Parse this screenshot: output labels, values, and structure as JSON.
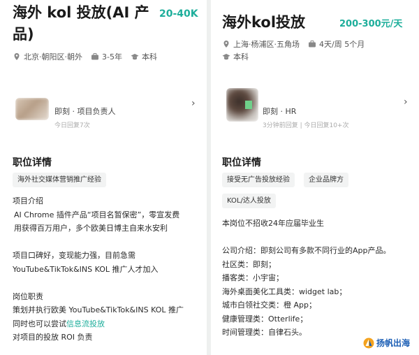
{
  "left": {
    "title_line1": "海外 kol 投放(AI 产",
    "title_line2": "品)",
    "salary": "20-40K",
    "location": "北京·朝阳区·朝外",
    "experience": "3-5年",
    "education": "本科",
    "hr_name": "即刻 · 项目负责人",
    "hr_status": "今日回复7次",
    "section_title": "职位详情",
    "tags": [
      "海外社交媒体营销推广经验"
    ],
    "lines": [
      "项目介绍",
      "AI Chrome 插件产品“项目名暂保密”，零宣发费",
      "用获得百万用户，多个欧美日博主自来水安利",
      "",
      "项目口碑好，变现能力强，目前急需",
      "YouTube&TikTok&INS KOL 推广人才加入",
      "",
      "岗位职责",
      "策划并执行欧美 YouTube&TikTok&INS KOL 推广"
    ],
    "line_hl_prefix": "同时也可以尝试",
    "line_hl_text": "信息流投放",
    "line_last": "对项目的投放 ROI 负责"
  },
  "right": {
    "title": "海外kol投放",
    "salary": "200-300元/天",
    "location": "上海·杨浦区·五角场",
    "schedule": "4天/周 5个月",
    "education": "本科",
    "hr_name": "即刻 · HR",
    "hr_status": "3分钟前回复 | 今日回复10+次",
    "section_title": "职位详情",
    "tags": [
      "接受无广告投放经验",
      "企业品牌方",
      "KOL/达人投放"
    ],
    "lines": [
      "本岗位不招收24年应届毕业生",
      "",
      "公司介绍：即刻公司有多款不同行业的App产品。",
      "社区类：即刻；",
      "播客类：小宇宙；",
      "海外桌面美化工具类：widget lab；",
      "城市白领社交类：橙 App；",
      "健康管理类：Otterlife；",
      "时间管理类：自律石头。"
    ]
  },
  "watermark": {
    "text": "扬帆出海"
  },
  "colors": {
    "accent": "#1dae9b",
    "brand_blue": "#1d5fb5"
  }
}
